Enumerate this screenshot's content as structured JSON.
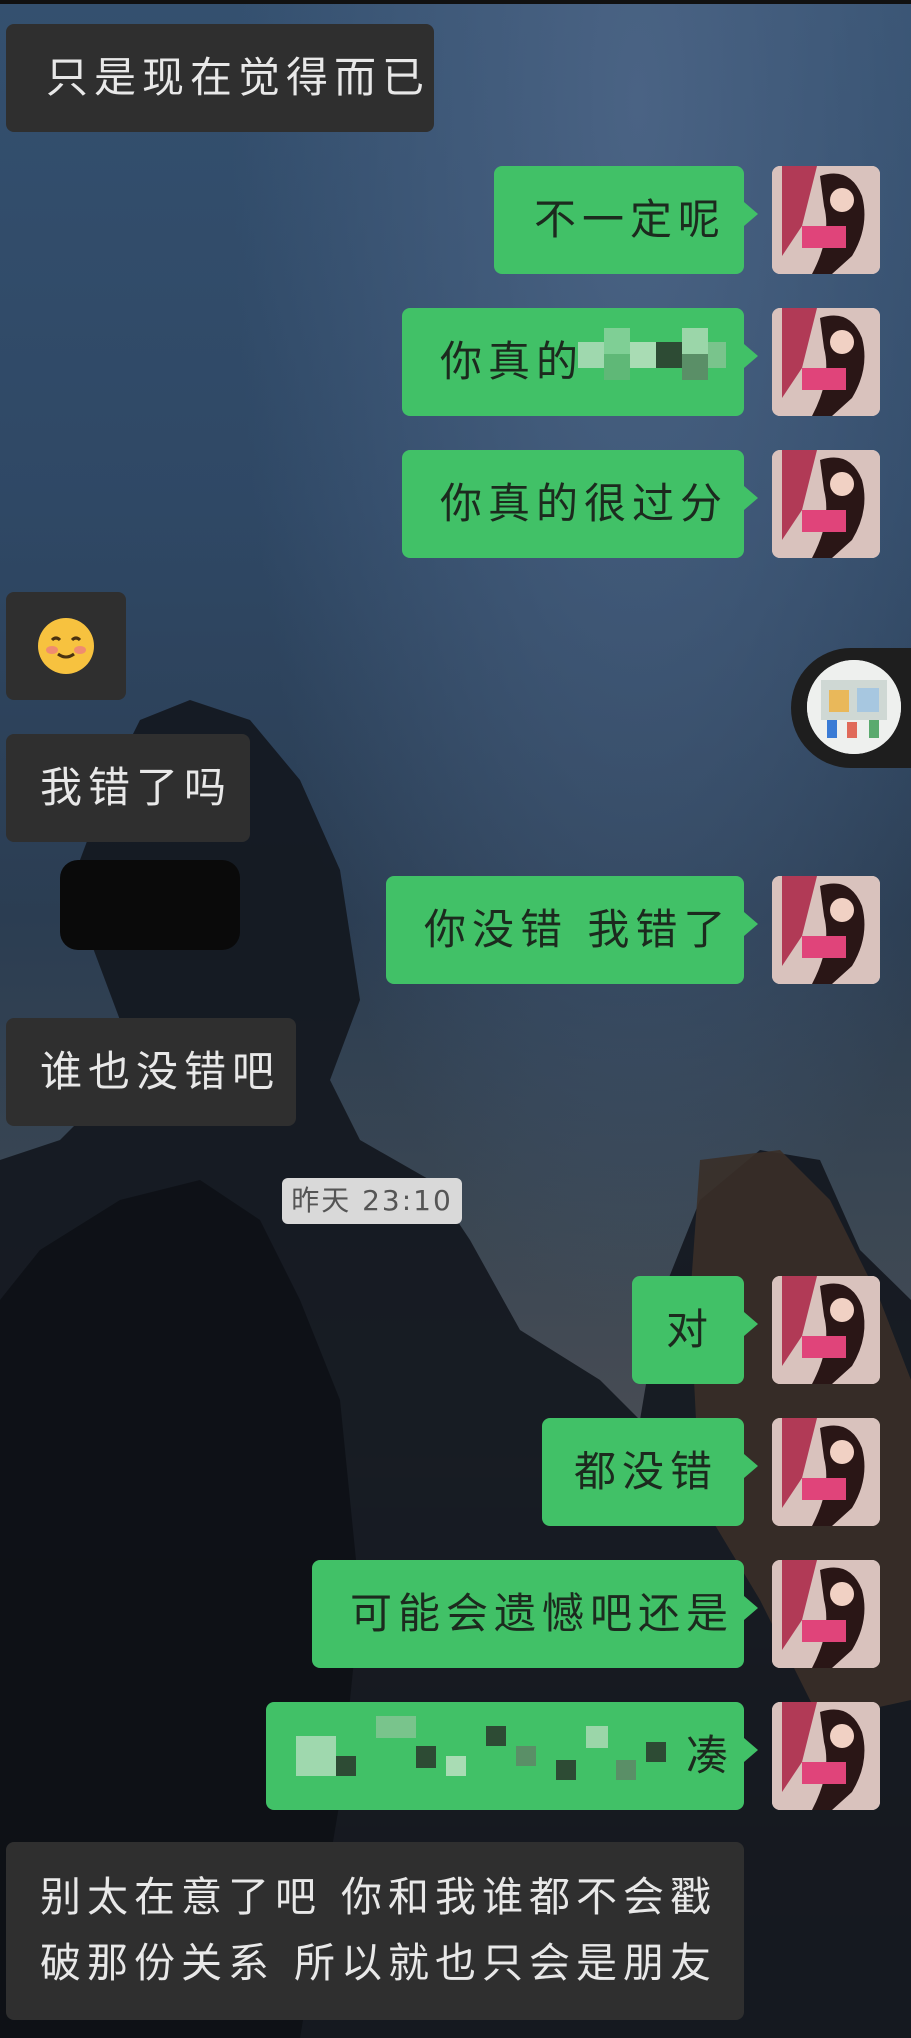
{
  "messages": [
    {
      "side": "left",
      "text": "只是现在觉得而已"
    },
    {
      "side": "right",
      "text": "不一定呢"
    },
    {
      "side": "right",
      "text": "你真的"
    },
    {
      "side": "right",
      "text": "你真的很过分"
    },
    {
      "side": "left",
      "text": "☺️"
    },
    {
      "side": "left",
      "text": "我错了吗"
    },
    {
      "side": "right",
      "text": "你没错 我错了"
    },
    {
      "side": "left",
      "text": "谁也没错吧"
    },
    {
      "side": "right",
      "text": "对"
    },
    {
      "side": "right",
      "text": "都没错"
    },
    {
      "side": "right",
      "text": "可能会遗憾吧还是"
    },
    {
      "side": "right",
      "text": "凑"
    },
    {
      "side": "left",
      "text": "别太在意了吧 你和我谁都不会戳破那份关系 所以就也只会是朋友"
    }
  ],
  "timestamp": "昨天 23:10",
  "colors": {
    "bubble_right": "#41c167",
    "bubble_left": "#2f2f2f",
    "timestamp_bg": "#d9d9d9"
  },
  "icons": {
    "emoji": "smiling-face-icon",
    "avatar": "user-avatar",
    "float": "floating-video-thumbnail"
  }
}
